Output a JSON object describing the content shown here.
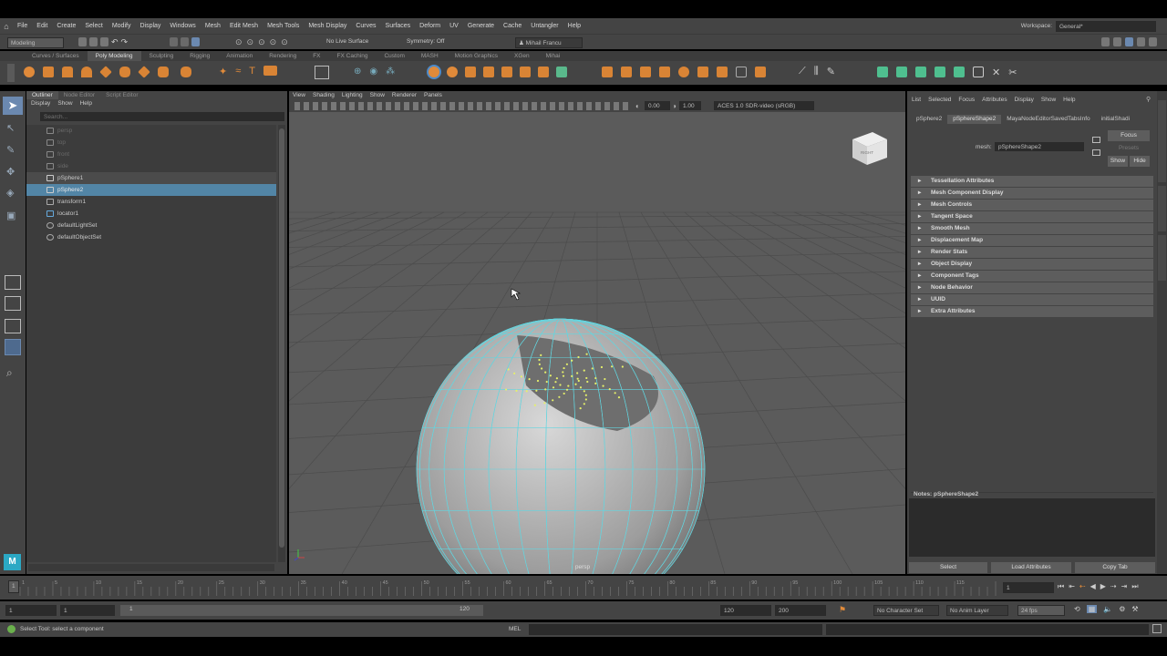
{
  "menubar": {
    "items": [
      "File",
      "Edit",
      "Create",
      "Select",
      "Modify",
      "Display",
      "Windows",
      "Mesh",
      "Edit Mesh",
      "Mesh Tools",
      "Mesh Display",
      "Curves",
      "Surfaces",
      "Deform",
      "UV",
      "Generate",
      "Cache",
      "Untangler",
      "Help"
    ],
    "workspace_label": "Workspace:",
    "workspace_value": "General*"
  },
  "statusline": {
    "mode": "Modeling",
    "live_surface": "No Live Surface",
    "symmetry": "Symmetry: Off",
    "user": "Mihail Francu"
  },
  "shelf": {
    "tabs": [
      "Curves / Surfaces",
      "Poly Modeling",
      "Sculpting",
      "Rigging",
      "Animation",
      "Rendering",
      "FX",
      "FX Caching",
      "Custom",
      "MASH",
      "Motion Graphics",
      "XGen",
      "Mihai"
    ],
    "active_tab": "Poly Modeling"
  },
  "outliner": {
    "tabs": [
      "Outliner",
      "Node Editor",
      "Script Editor"
    ],
    "menu": [
      "Display",
      "Show",
      "Help"
    ],
    "search_placeholder": "Search...",
    "items": [
      {
        "label": "persp",
        "dim": true,
        "icon": "camera-icon"
      },
      {
        "label": "top",
        "dim": true,
        "icon": "camera-icon"
      },
      {
        "label": "front",
        "dim": true,
        "icon": "camera-icon"
      },
      {
        "label": "side",
        "dim": true,
        "icon": "camera-icon"
      },
      {
        "label": "pSphere1",
        "icon": "mesh-icon"
      },
      {
        "label": "pSphere2",
        "selected": true,
        "icon": "mesh-icon"
      },
      {
        "label": "transform1",
        "icon": "transform-icon"
      },
      {
        "label": "locator1",
        "icon": "locator-icon"
      },
      {
        "label": "defaultLightSet",
        "icon": "set-icon"
      },
      {
        "label": "defaultObjectSet",
        "icon": "set-icon"
      }
    ]
  },
  "viewport": {
    "menu": [
      "View",
      "Shading",
      "Lighting",
      "Show",
      "Renderer",
      "Panels"
    ],
    "exposure": "0.00",
    "gamma": "1.00",
    "colorspace": "ACES 1.0 SDR-video (sRGB)",
    "camera_label": "persp",
    "viewcube_label": "RIGHT"
  },
  "attr": {
    "menu": [
      "List",
      "Selected",
      "Focus",
      "Attributes",
      "Display",
      "Show",
      "Help"
    ],
    "tabs": [
      "pSphere2",
      "pSphereShape2",
      "MayaNodeEditorSavedTabsInfo",
      "initialShadi"
    ],
    "mesh_label": "mesh:",
    "mesh_value": "pSphereShape2",
    "focus": "Focus",
    "presets": "Presets",
    "show": "Show",
    "hide": "Hide",
    "sections": [
      "Tessellation Attributes",
      "Mesh Component Display",
      "Mesh Controls",
      "Tangent Space",
      "Smooth Mesh",
      "Displacement Map",
      "Render Stats",
      "Object Display",
      "Component Tags",
      "Node Behavior",
      "UUID",
      "Extra Attributes"
    ],
    "notes_label": "Notes:  pSphereShape2",
    "buttons": [
      "Select",
      "Load Attributes",
      "Copy Tab"
    ]
  },
  "timeline": {
    "ticks": [
      "1",
      "5",
      "10",
      "15",
      "20",
      "25",
      "30",
      "35",
      "40",
      "45",
      "50",
      "55",
      "60",
      "65",
      "70",
      "75",
      "80",
      "85",
      "90",
      "95",
      "100",
      "105",
      "110",
      "115",
      "120"
    ],
    "current_frame": "1"
  },
  "range": {
    "start": "1",
    "start2": "1",
    "slider_start": "1",
    "slider_end": "120",
    "end": "120",
    "end2": "200",
    "character_set": "No Character Set",
    "anim_layer": "No Anim Layer",
    "fps": "24 fps"
  },
  "cmd": {
    "help": "Select Tool: select a component",
    "lang": "MEL"
  },
  "toolbox": {
    "logo": "M"
  }
}
